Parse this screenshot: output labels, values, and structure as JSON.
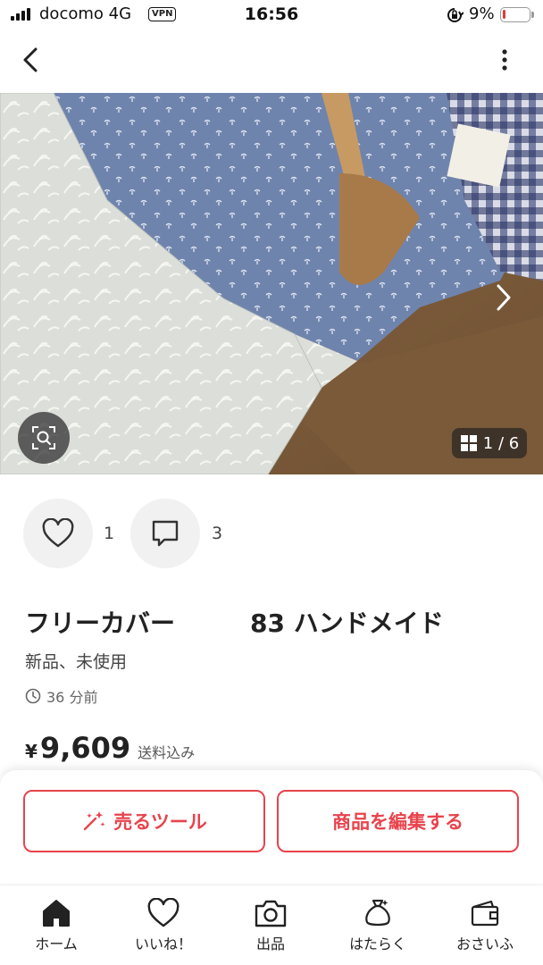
{
  "status_bar": {
    "carrier": "docomo",
    "network": "4G",
    "vpn": "VPN",
    "time": "16:56",
    "battery_pct_label": "9%",
    "battery_level": 0.09
  },
  "gallery": {
    "counter": "1 / 6"
  },
  "engagement": {
    "likes": "1",
    "comments": "3"
  },
  "item": {
    "title": "フリーカバー　　　83 ハンドメイド",
    "condition": "新品、未使用",
    "posted": "36 分前",
    "currency": "¥",
    "price": "9,609",
    "shipping": "送料込み"
  },
  "actions": {
    "sell_tool": "売るツール",
    "edit_item": "商品を編集する"
  },
  "tabs": [
    {
      "label": "ホーム",
      "icon": "home-icon"
    },
    {
      "label": "いいね！",
      "icon": "heart-icon"
    },
    {
      "label": "出品",
      "icon": "camera-icon"
    },
    {
      "label": "はたらく",
      "icon": "money-bag-icon"
    },
    {
      "label": "おさいふ",
      "icon": "wallet-icon"
    }
  ],
  "colors": {
    "accent": "#e8434d",
    "battery_low": "#e53935"
  }
}
